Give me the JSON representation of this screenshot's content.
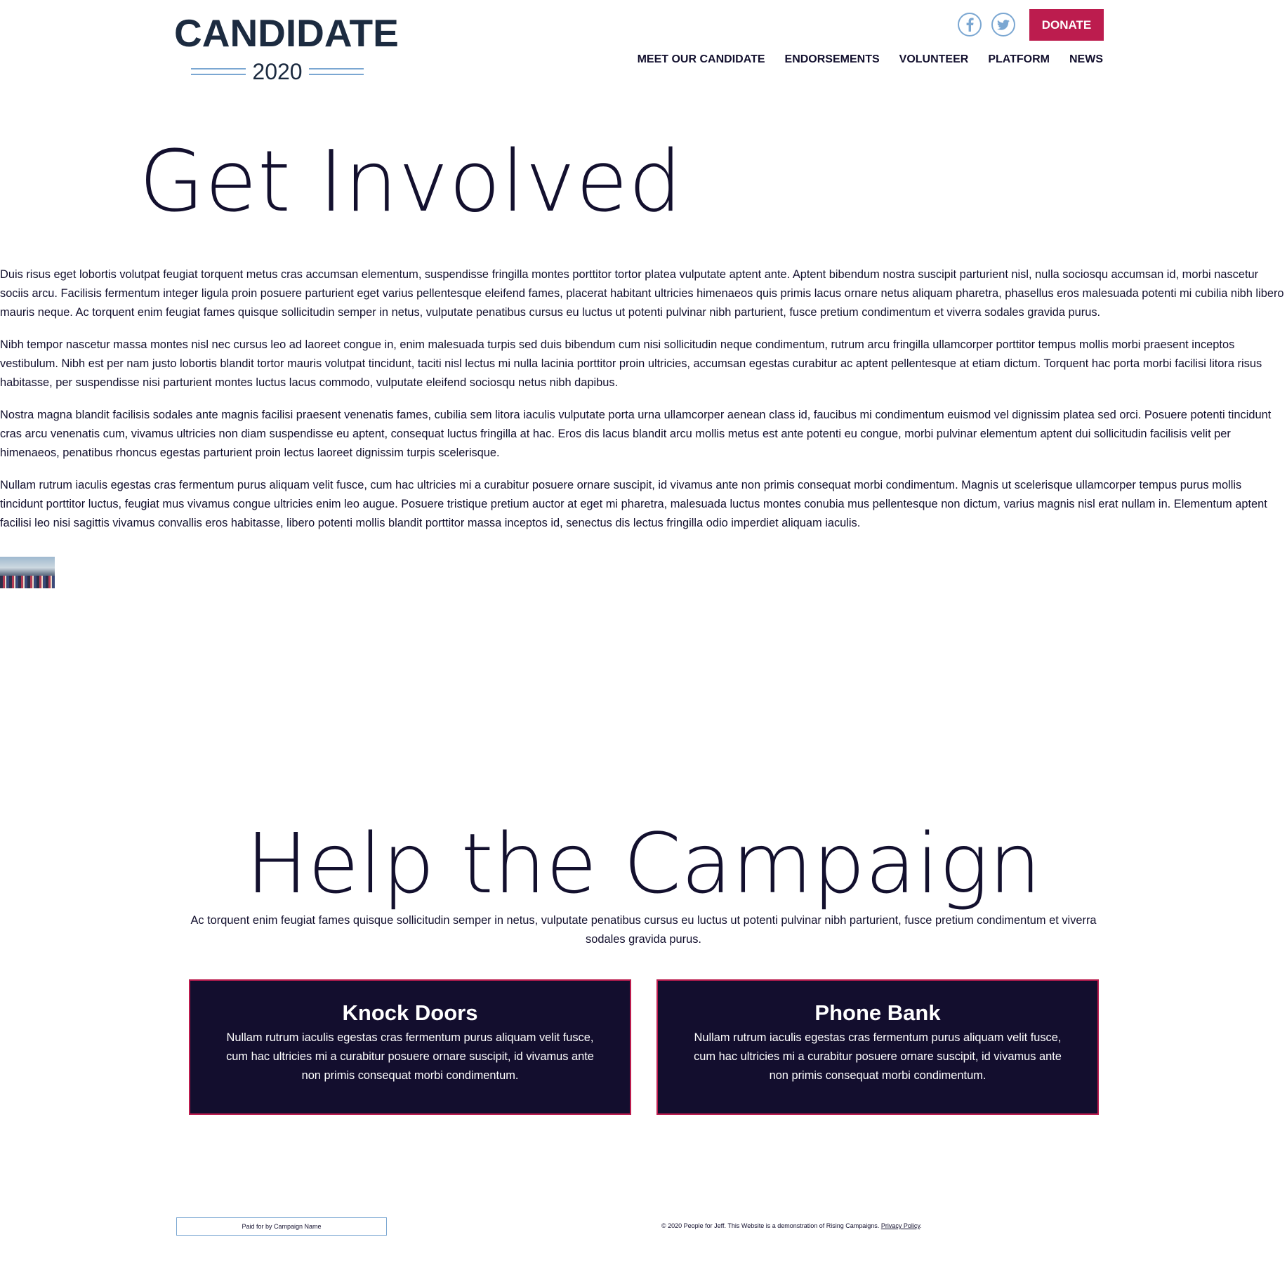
{
  "header": {
    "logo": {
      "name": "CANDIDATE",
      "year": "2020"
    },
    "social": [
      {
        "icon": "facebook-icon"
      },
      {
        "icon": "twitter-icon"
      }
    ],
    "donate_label": "DONATE",
    "nav": [
      {
        "label": "MEET OUR CANDIDATE"
      },
      {
        "label": "ENDORSEMENTS"
      },
      {
        "label": "VOLUNTEER"
      },
      {
        "label": "PLATFORM"
      },
      {
        "label": "NEWS"
      }
    ]
  },
  "get_involved": {
    "title": "Get Involved",
    "paragraphs": [
      "Duis risus eget lobortis volutpat feugiat torquent metus cras accumsan elementum, suspendisse fringilla montes porttitor tortor platea vulputate aptent ante. Aptent bibendum nostra suscipit parturient nisl, nulla sociosqu accumsan id, morbi nascetur sociis arcu. Facilisis fermentum integer ligula proin posuere parturient eget varius pellentesque eleifend fames, placerat habitant ultricies himenaeos quis primis lacus ornare netus aliquam pharetra, phasellus eros malesuada potenti mi cubilia nibh libero mauris neque. Ac torquent enim feugiat fames quisque sollicitudin semper in netus, vulputate penatibus cursus eu luctus ut potenti pulvinar nibh parturient, fusce pretium condimentum et viverra sodales gravida purus.",
      "Nibh tempor nascetur massa montes nisl nec cursus leo ad laoreet congue in, enim malesuada turpis sed duis bibendum cum nisi sollicitudin neque condimentum, rutrum arcu fringilla ullamcorper porttitor tempus mollis morbi praesent inceptos vestibulum. Nibh est per nam justo lobortis blandit tortor mauris volutpat tincidunt, taciti nisl lectus mi nulla lacinia porttitor proin ultricies, accumsan egestas curabitur ac aptent pellentesque at etiam dictum. Torquent hac porta morbi facilisi litora risus habitasse, per suspendisse nisi parturient montes luctus lacus commodo, vulputate eleifend sociosqu netus nibh dapibus.",
      "Nostra magna blandit facilisis sodales ante magnis facilisi praesent venenatis fames, cubilia sem litora iaculis vulputate porta urna ullamcorper aenean class id, faucibus mi condimentum euismod vel dignissim platea sed orci. Posuere potenti tincidunt cras arcu venenatis cum, vivamus ultricies non diam suspendisse eu aptent, consequat luctus fringilla at hac. Eros dis lacus blandit arcu mollis metus est ante potenti eu congue, morbi pulvinar elementum aptent dui sollicitudin facilisis velit per himenaeos, penatibus rhoncus egestas parturient proin lectus laoreet dignissim turpis scelerisque.",
      "Nullam rutrum iaculis egestas cras fermentum purus aliquam velit fusce, cum hac ultricies mi a curabitur posuere ornare suscipit, id vivamus ante non primis consequat morbi condimentum. Magnis ut scelerisque ullamcorper tempus purus mollis tincidunt porttitor luctus, feugiat mus vivamus congue ultricies enim leo augue. Posuere tristique pretium auctor at eget mi pharetra, malesuada luctus montes conubia mus pellentesque non dictum, varius magnis nisl erat nullam in. Elementum aptent facilisi leo nisi sagittis vivamus convallis eros habitasse, libero potenti mollis blandit porttitor massa inceptos id, senectus dis lectus fringilla odio imperdiet aliquam iaculis."
    ]
  },
  "help": {
    "title": "Help the Campaign",
    "intro": "Ac torquent enim feugiat fames quisque sollicitudin semper in netus, vulputate penatibus cursus eu luctus ut potenti pulvinar nibh parturient, fusce pretium condimentum et viverra sodales gravida purus.",
    "cards": [
      {
        "title": "Knock Doors",
        "text": "Nullam rutrum iaculis egestas cras fermentum purus aliquam velit fusce, cum hac ultricies mi a curabitur posuere ornare suscipit, id vivamus ante non primis consequat morbi condimentum."
      },
      {
        "title": "Phone Bank",
        "text": "Nullam rutrum iaculis egestas cras fermentum purus aliquam velit fusce, cum hac ultricies mi a curabitur posuere ornare suscipit, id vivamus ante non primis consequat morbi condimentum."
      }
    ]
  },
  "footer": {
    "paid_for": "Paid for by Campaign Name",
    "copyright": "© 2020 People for Jeff. This Website is a demonstration of Rising Campaigns.",
    "privacy_link": "Privacy Policy",
    "privacy_suffix": "."
  },
  "colors": {
    "navy": "#13102e",
    "logo_navy": "#1c2b40",
    "accent_red": "#bc1c4e",
    "light_blue": "#7ba7d2"
  }
}
